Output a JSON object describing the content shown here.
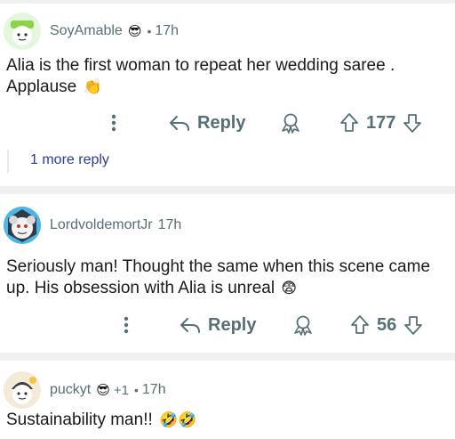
{
  "comments": [
    {
      "username": "SoyAmable",
      "flair_icon": "sunglasses-emoji",
      "flair_glyph": "😎",
      "time_sep": "•",
      "time": "17h",
      "text": "Alia is the first woman to repeat her wedding saree . Applause",
      "text_emoji": "👏",
      "reply_label": "Reply",
      "score": "177",
      "more_replies": "1 more reply"
    },
    {
      "username": "LordvoldemortJr",
      "time": "17h",
      "text": "Seriously man! Thought the same when this scene came up. His obsession with Alia is unreal",
      "text_emoji": "😨",
      "reply_label": "Reply",
      "score": "56"
    },
    {
      "username": "puckyt",
      "flair_icon": "sunglasses-emoji",
      "flair_glyph": "😎",
      "flair_extra": "+1",
      "time_sep": "•",
      "time": "17h",
      "text": "Sustainability man!!",
      "text_emoji": "🤣🤣"
    }
  ],
  "colors": {
    "meta": "#576f76",
    "link": "#2a3c9c",
    "separator": "#eef0f2",
    "avatar1_bg": "#dff5d6",
    "avatar2_bg": "#4db6e8",
    "avatar3_bg": "#f3ead8"
  }
}
